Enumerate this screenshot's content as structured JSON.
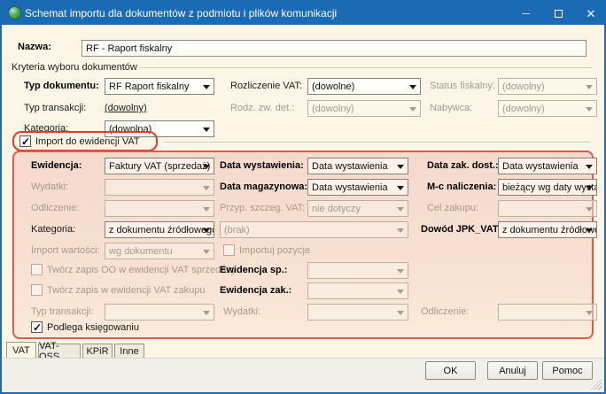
{
  "window": {
    "title": "Schemat importu dla dokumentów z podmiotu i plików komunikacji",
    "close_glyph": "✕"
  },
  "name_row": {
    "label": "Nazwa:",
    "value": "RF - Raport fiskalny"
  },
  "criteria": {
    "group_title": "Kryteria wyboru dokumentów",
    "typ_dokumentu_label": "Typ dokumentu:",
    "typ_dokumentu_value": "RF Raport fiskalny",
    "rozliczenie_vat_label": "Rozliczenie VAT:",
    "rozliczenie_vat_value": "(dowolne)",
    "status_fiskalny_label": "Status fiskalny:",
    "status_fiskalny_value": "(dowolny)",
    "typ_transakcji_label": "Typ transakcji:",
    "typ_transakcji_value": "(dowolny)",
    "rodz_zw_det_label": "Rodz. zw. det.:",
    "rodz_zw_det_value": "(dowolny)",
    "nabywca_label": "Nabywca:",
    "nabywca_value": "(dowolny)",
    "kategoria_label": "Kategoria:",
    "kategoria_value": "(dowolna)"
  },
  "vat": {
    "import_label": "Import do ewidencji VAT",
    "ewidencja_label": "Ewidencja:",
    "ewidencja_value": "Faktury VAT (sprzedaż)",
    "data_wystawienia_label": "Data wystawienia:",
    "data_wystawienia_value": "Data wystawienia",
    "data_zak_dost_label": "Data zak. dost.:",
    "data_zak_dost_value": "Data wystawienia",
    "wydatki_label": "Wydatki:",
    "wydatki_value": "",
    "data_magazynowa_label": "Data magazynowa:",
    "data_magazynowa_value": "Data wystawienia",
    "mc_naliczenia_label": "M-c naliczenia:",
    "mc_naliczenia_value": "bieżący wg daty wysta",
    "odliczenie_label": "Odliczenie:",
    "odliczenie_value": "",
    "przyp_szczeg_vat_label": "Przyp. szczeg. VAT:",
    "przyp_szczeg_vat_value": "nie dotyczy",
    "cel_zakupu_label": "Cel zakupu:",
    "cel_zakupu_value": "",
    "kategoria_label": "Kategoria:",
    "kategoria_value": "z dokumentu źródłowego",
    "kategoria_brak_value": "(brak)",
    "dowod_jpk_label": "Dowód JPK_VAT:",
    "dowod_jpk_value": "z dokumentu źródłowe",
    "import_wartosci_label": "Import wartości:",
    "import_wartosci_value": "wg dokumentu",
    "importuj_pozycje_label": "Importuj pozycje",
    "tworz_oo_label": "Twórz zapis OO w ewidencji VAT sprzedaży",
    "ewidencja_sp_label": "Ewidencja sp.:",
    "ewidencja_sp_value": "",
    "tworz_zakup_label": "Twórz zapis w ewidencji VAT zakupu",
    "ewidencja_zak_label": "Ewidencja zak.:",
    "ewidencja_zak_value": "",
    "typ_transakcji_label": "Typ transakcji:",
    "typ_transakcji_value": "",
    "wydatki2_label": "Wydatki:",
    "wydatki2_value": "",
    "odliczenie2_label": "Odliczenie:",
    "odliczenie2_value": "",
    "podlega_label": "Podlega księgowaniu"
  },
  "tabs": {
    "items": [
      {
        "label": "VAT"
      },
      {
        "label": "VAT-OSS"
      },
      {
        "label": "KPiR"
      },
      {
        "label": "Inne"
      }
    ],
    "active": "VAT"
  },
  "buttons": {
    "ok": "OK",
    "anuluj": "Anuluj",
    "pomoc": "Pomoc"
  },
  "colors": {
    "titlebar": "#1b6bb4",
    "dialog_bg": "#fdf6e7",
    "highlight_red": "#df3b2e",
    "panel_bg_top": "#f5d9cd",
    "panel_bg_bottom": "#fbeadb"
  }
}
